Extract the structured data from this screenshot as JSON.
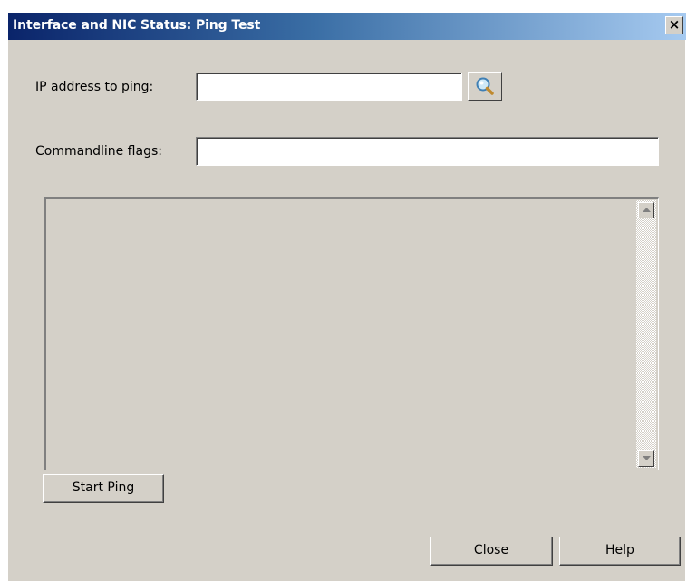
{
  "window": {
    "title": "Interface and NIC Status: Ping Test",
    "close_glyph": "×"
  },
  "form": {
    "ip_label": "IP address to ping:",
    "ip_value": "",
    "flags_label": "Commandline flags:",
    "flags_value": "",
    "lookup_icon": "magnifier-icon"
  },
  "output": {
    "text": ""
  },
  "buttons": {
    "start_ping": "Start Ping",
    "close": "Close",
    "help": "Help"
  },
  "colors": {
    "title_gradient_start": "#0a246a",
    "title_gradient_end": "#a6caf0",
    "dialog_face": "#d4d0c8"
  }
}
